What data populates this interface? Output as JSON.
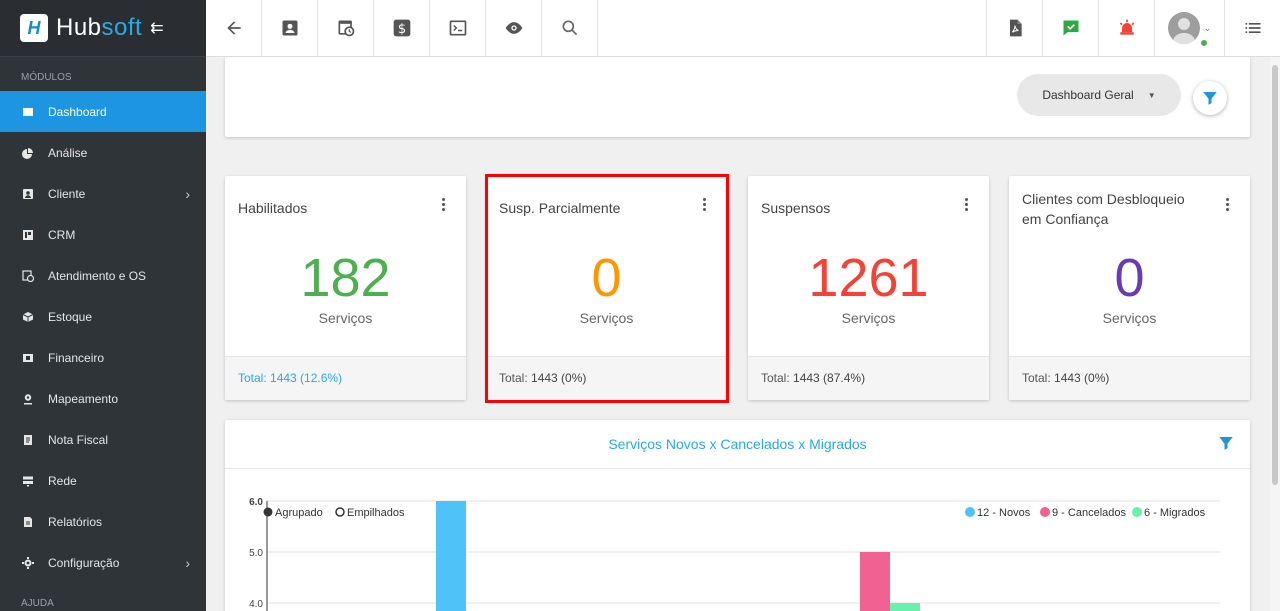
{
  "brand": {
    "name_a": "Hub",
    "name_b": "soft"
  },
  "sidebar": {
    "section_modules": "MÓDULOS",
    "section_help": "AJUDA",
    "items": [
      {
        "label": "Dashboard",
        "icon": "dashboard-icon",
        "active": true
      },
      {
        "label": "Análise",
        "icon": "pie-chart-icon"
      },
      {
        "label": "Cliente",
        "icon": "contact-icon",
        "has_children": true
      },
      {
        "label": "CRM",
        "icon": "board-icon"
      },
      {
        "label": "Atendimento e OS",
        "icon": "calendar-clock-icon"
      },
      {
        "label": "Estoque",
        "icon": "box-icon"
      },
      {
        "label": "Financeiro",
        "icon": "money-icon"
      },
      {
        "label": "Mapeamento",
        "icon": "location-icon"
      },
      {
        "label": "Nota Fiscal",
        "icon": "receipt-icon"
      },
      {
        "label": "Rede",
        "icon": "server-icon"
      },
      {
        "label": "Relatórios",
        "icon": "file-icon"
      },
      {
        "label": "Configuração",
        "icon": "gear-icon",
        "has_children": true
      }
    ]
  },
  "topbar": {
    "icons": [
      "back-arrow-icon",
      "contact-card-icon",
      "calendar-clock-icon",
      "dollar-icon",
      "terminal-icon",
      "eye-icon",
      "search-icon"
    ],
    "right_icons": [
      "pdf-icon",
      "check-message-icon",
      "alarm-icon",
      "user-avatar",
      "list-icon"
    ],
    "colors": {
      "check": "#2eaa45",
      "alarm": "#f44336"
    }
  },
  "filter": {
    "dashboard_select": "Dashboard Geral"
  },
  "stats": [
    {
      "title": "Habilitados",
      "value": "182",
      "label": "Serviços",
      "total_label": "Total:",
      "total_value": "1443 (12.6%)",
      "color": "#4caf50",
      "foot_blue": true
    },
    {
      "title": "Susp. Parcialmente",
      "value": "0",
      "label": "Serviços",
      "total_label": "Total:",
      "total_value": "1443 (0%)",
      "color": "#ff9800"
    },
    {
      "title": "Suspensos",
      "value": "1261",
      "label": "Serviços",
      "total_label": "Total:",
      "total_value": "1443 (87.4%)",
      "color": "#f44336"
    },
    {
      "title": "Clientes com Desbloqueio em Confiança",
      "value": "0",
      "label": "Serviços",
      "total_label": "Total:",
      "total_value": "1443 (0%)",
      "color": "#673ab7"
    }
  ],
  "chart_data": {
    "type": "bar",
    "title": "Serviços Novos x Cancelados x Migrados",
    "mode_options": [
      "Agrupado",
      "Empilhados"
    ],
    "mode_selected": "Agrupado",
    "y_ticks": [
      6.0,
      5.0,
      4.0
    ],
    "ylim": [
      0,
      6
    ],
    "legend_position": "top-right",
    "series": [
      {
        "name": "12 - Novos",
        "color": "#4fc3f7",
        "bar_values": [
          6
        ]
      },
      {
        "name": "9 - Cancelados",
        "color": "#f06292",
        "bar_values": [
          5
        ]
      },
      {
        "name": "6 - Migrados",
        "color": "#69f0ae",
        "bar_values": [
          4
        ]
      }
    ]
  }
}
